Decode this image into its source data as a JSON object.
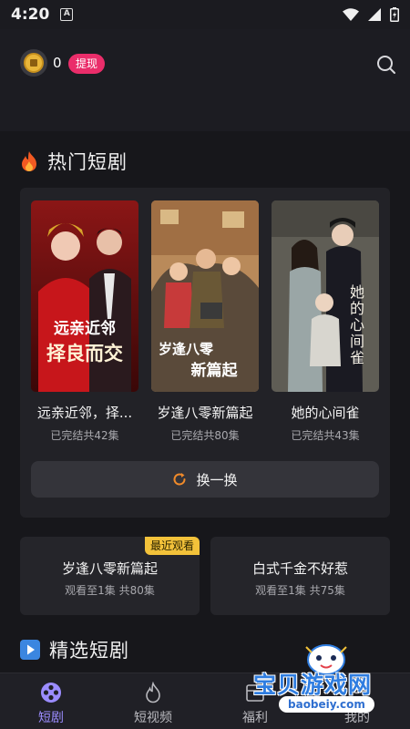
{
  "status": {
    "time": "4:20",
    "notif_icon": "A"
  },
  "header": {
    "coin_count": "0",
    "withdraw_label": "提现"
  },
  "hot": {
    "title": "热门短剧",
    "items": [
      {
        "name": "远亲近邻，择...",
        "meta": "已完结共42集",
        "poster_text_1": "远亲近邻",
        "poster_text_2": "择良而交"
      },
      {
        "name": "岁逢八零新篇起",
        "meta": "已完结共80集",
        "poster_text_1": "岁逢八零",
        "poster_text_2": "新篇起"
      },
      {
        "name": "她的心间雀",
        "meta": "已完结共43集",
        "poster_text_1": "她的心间雀"
      }
    ],
    "shuffle_label": "换一换"
  },
  "recent": [
    {
      "title": "岁逢八零新篇起",
      "sub": "观看至1集 共80集",
      "badge": "最近观看"
    },
    {
      "title": "白式千金不好惹",
      "sub": "观看至1集 共75集"
    }
  ],
  "featured": {
    "title": "精选短剧"
  },
  "nav": [
    {
      "label": "短剧",
      "icon": "drama-icon",
      "active": true
    },
    {
      "label": "短视频",
      "icon": "flame-icon"
    },
    {
      "label": "福利",
      "icon": "gift-icon"
    },
    {
      "label": "我的",
      "icon": "user-icon"
    }
  ],
  "watermark": {
    "text": "宝贝游戏网",
    "url": "baobeiy.com"
  },
  "colors": {
    "accent": "#ea2d6a",
    "nav_active": "#9b8cff",
    "badge": "#f3c23a",
    "background": "#17171b"
  }
}
